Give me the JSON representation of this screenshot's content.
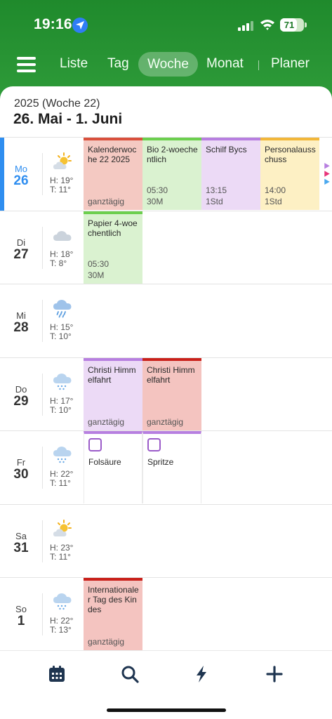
{
  "status_bar": {
    "time": "19:16",
    "battery": "71",
    "battery_level": 0.71
  },
  "nav": {
    "tabs": [
      {
        "label": "Liste"
      },
      {
        "label": "Tag"
      },
      {
        "label": "Woche",
        "active": true
      },
      {
        "label": "Monat"
      },
      {
        "label": "Planer"
      }
    ]
  },
  "week": {
    "title": "2025 (Woche 22)",
    "range": "26. Mai - 1. Juni"
  },
  "days": [
    {
      "dow": "Mo",
      "num": "26",
      "today": true,
      "weather": "sun-cloud-icon",
      "high": "H: 19°",
      "low": "T: 11°",
      "events": [
        {
          "title": "Kalenderwoche 22 2025",
          "time": "",
          "dur": "",
          "allday": "ganztägig",
          "bg": "#f4c9c2",
          "accent": "#d9503d"
        },
        {
          "title": "Bio 2-woechentlich",
          "time": "05:30",
          "dur": "30M",
          "allday": "",
          "bg": "#daf2d0",
          "accent": "#6ccf4e"
        },
        {
          "title": "Schilf Bycs",
          "time": "13:15",
          "dur": "1Std",
          "allday": "",
          "bg": "#ecdaf6",
          "accent": "#b77fe0"
        },
        {
          "title": "Personalausschuss",
          "time": "14:00",
          "dur": "1Std",
          "allday": "",
          "bg": "#fdf0c4",
          "accent": "#f2b73a"
        }
      ]
    },
    {
      "dow": "Di",
      "num": "27",
      "weather": "cloud-icon",
      "high": "H: 18°",
      "low": "T: 8°",
      "events": [
        {
          "title": "Papier 4-woechentlich",
          "time": "05:30",
          "dur": "30M",
          "allday": "",
          "bg": "#daf2d0",
          "accent": "#6ccf4e"
        }
      ]
    },
    {
      "dow": "Mi",
      "num": "28",
      "weather": "rain-icon",
      "high": "H: 15°",
      "low": "T: 10°",
      "events": []
    },
    {
      "dow": "Do",
      "num": "29",
      "weather": "drizzle-icon",
      "high": "H: 17°",
      "low": "T: 10°",
      "events": [
        {
          "title": "Christi Himmelfahrt",
          "time": "",
          "dur": "",
          "allday": "ganztägig",
          "bg": "#ecdaf6",
          "accent": "#b77fe0"
        },
        {
          "title": "Christi Himmelfahrt",
          "time": "",
          "dur": "",
          "allday": "ganztägig",
          "bg": "#f4c4c0",
          "accent": "#c9201a"
        }
      ]
    },
    {
      "dow": "Fr",
      "num": "30",
      "weather": "drizzle-icon",
      "high": "H: 22°",
      "low": "T: 11°",
      "tasks": [
        {
          "title": "Folsäure"
        },
        {
          "title": "Spritze"
        }
      ]
    },
    {
      "dow": "Sa",
      "num": "31",
      "weather": "sun-cloud-icon",
      "high": "H: 23°",
      "low": "T: 11°",
      "events": []
    },
    {
      "dow": "So",
      "num": "1",
      "weather": "drizzle-icon",
      "high": "H: 22°",
      "low": "T: 13°",
      "events": [
        {
          "title": "Internationaler Tag des Kindes",
          "time": "",
          "dur": "",
          "allday": "ganztägig",
          "bg": "#f4c4c0",
          "accent": "#c9201a"
        }
      ]
    }
  ],
  "colors": {
    "header_green": "#2f9c3a",
    "today_blue": "#2f8ef0",
    "icon_navy": "#1f3550"
  },
  "bottom_bar": [
    "calendar-icon",
    "search-icon",
    "bolt-icon",
    "plus-icon"
  ]
}
